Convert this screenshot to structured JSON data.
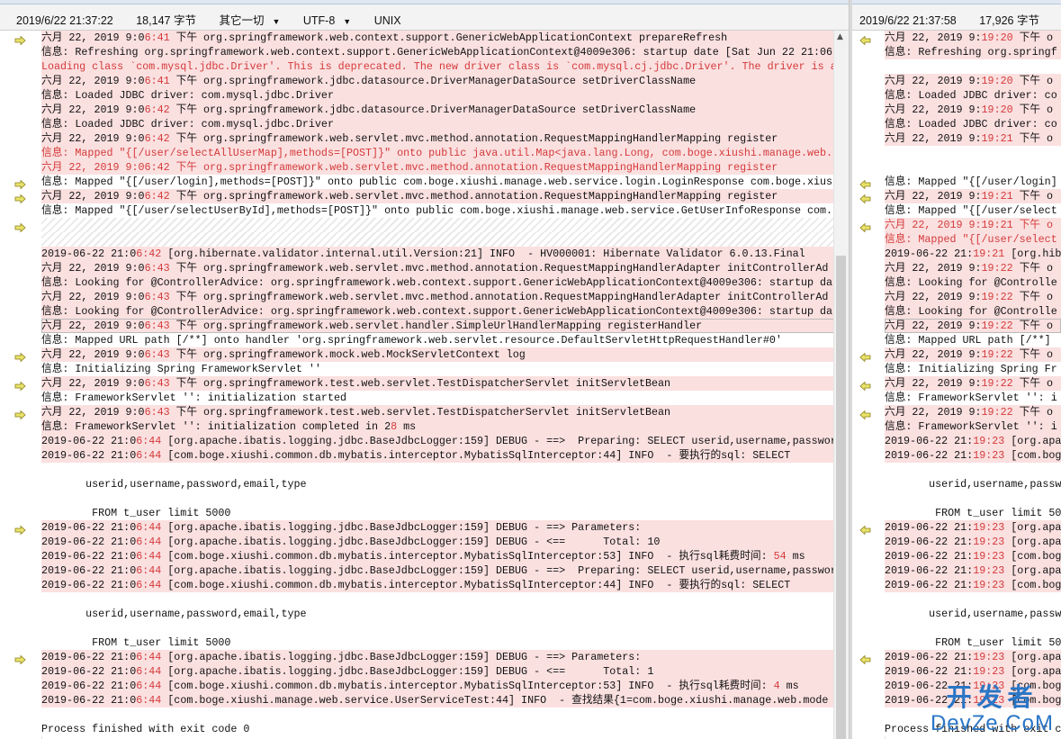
{
  "left_status": {
    "timestamp": "2019/6/22 21:37:22",
    "size": "18,147 字节",
    "filter": "其它一切",
    "encoding": "UTF-8",
    "lineend": "UNIX"
  },
  "right_status": {
    "timestamp": "2019/6/22 21:37:58",
    "size": "17,926 字节",
    "filter": "其"
  },
  "colors": {
    "diff_bg": "#fbe0e0",
    "highlight": "#d43a3a",
    "arrow": "#e9e36a",
    "watermark": "#2a76c6"
  },
  "icon_names": [
    "diff-arrow-icon",
    "scroll-up-icon"
  ],
  "left_lines": [
    {
      "t": "六月 22, 2019 9:0",
      "h": "6:41",
      "t2": " 下午 org.springframework.web.context.support.GenericWebApplicationContext prepareRefresh",
      "s": "d",
      "a": 1
    },
    {
      "t": "信息: Refreshing org.springframework.web.context.support.GenericWebApplicationContext@4009e306: startup date [Sat Jun 22 21:06",
      "s": "d"
    },
    {
      "t": "Loading class `com.mysql.jdbc.Driver'. This is deprecated. The new driver class is `com.mysql.cj.jdbc.Driver'. The driver is a",
      "s": "d red"
    },
    {
      "t": "六月 22, 2019 9:0",
      "h": "6:41",
      "t2": " 下午 org.springframework.jdbc.datasource.DriverManagerDataSource setDriverClassName",
      "s": "d"
    },
    {
      "t": "信息: Loaded JDBC driver: com.mysql.jdbc.Driver",
      "s": "d"
    },
    {
      "t": "六月 22, 2019 9:0",
      "h": "6:42",
      "t2": " 下午 org.springframework.jdbc.datasource.DriverManagerDataSource setDriverClassName",
      "s": "d"
    },
    {
      "t": "信息: Loaded JDBC driver: com.mysql.jdbc.Driver",
      "s": "d"
    },
    {
      "t": "六月 22, 2019 9:0",
      "h": "6:42",
      "t2": " 下午 org.springframework.web.servlet.mvc.method.annotation.RequestMappingHandlerMapping register",
      "s": "d"
    },
    {
      "t": "信息: Mapped \"{[/user/selectAllUserMap],methods=[POST]}\" onto public java.util.Map<java.lang.Long, com.boge.xiushi.manage.web.",
      "s": "d red"
    },
    {
      "t": "六月 22, 2019 9:06:42 下午 org.springframework.web.servlet.mvc.method.annotation.RequestMappingHandlerMapping register",
      "s": "d red"
    },
    {
      "t": "信息: Mapped \"{[/user/login],methods=[POST]}\" onto public com.boge.xiushi.manage.web.service.login.LoginResponse com.boge.xius",
      "s": "gap",
      "a": 1
    },
    {
      "t": "六月 22, 2019 9:0",
      "h": "6:42",
      "t2": " 下午 org.springframework.web.servlet.mvc.method.annotation.RequestMappingHandlerMapping register",
      "s": "d",
      "a": 1
    },
    {
      "t": "信息: Mapped \"{[/user/selectUserById],methods=[POST]}\" onto public com.boge.xiushi.manage.web.service.GetUserInfoResponse com.",
      "s": "gap"
    },
    {
      "t": "",
      "s": "hatch",
      "a": 1
    },
    {
      "t": "",
      "s": "hatch"
    },
    {
      "t": "2019-06-22 21:0",
      "h": "6:42",
      "t2": " [org.hibernate.validator.internal.util.Version:21] INFO  - HV000001: Hibernate Validator 6.0.13.Final",
      "s": "d"
    },
    {
      "t": "六月 22, 2019 9:0",
      "h": "6:43",
      "t2": " 下午 org.springframework.web.servlet.mvc.method.annotation.RequestMappingHandlerAdapter initControllerAd",
      "s": "d"
    },
    {
      "t": "信息: Looking for @ControllerAdvice: org.springframework.web.context.support.GenericWebApplicationContext@4009e306: startup da",
      "s": "d"
    },
    {
      "t": "六月 22, 2019 9:0",
      "h": "6:43",
      "t2": " 下午 org.springframework.web.servlet.mvc.method.annotation.RequestMappingHandlerAdapter initControllerAd",
      "s": "d"
    },
    {
      "t": "信息: Looking for @ControllerAdvice: org.springframework.web.context.support.GenericWebApplicationContext@4009e306: startup da",
      "s": "d"
    },
    {
      "t": "六月 22, 2019 9:0",
      "h": "6:43",
      "t2": " 下午 org.springframework.web.servlet.handler.SimpleUrlHandlerMapping registerHandler",
      "s": "d sel"
    },
    {
      "t": "信息: Mapped URL path [/**] onto handler 'org.springframework.web.servlet.resource.DefaultServletHttpRequestHandler#0'",
      "s": "gap"
    },
    {
      "t": "六月 22, 2019 9:0",
      "h": "6:43",
      "t2": " 下午 org.springframework.mock.web.MockServletContext log",
      "s": "d",
      "a": 1
    },
    {
      "t": "信息: Initializing Spring FrameworkServlet ''",
      "s": "gap"
    },
    {
      "t": "六月 22, 2019 9:0",
      "h": "6:43",
      "t2": " 下午 org.springframework.test.web.servlet.TestDispatcherServlet initServletBean",
      "s": "d",
      "a": 1
    },
    {
      "t": "信息: FrameworkServlet '': initialization started",
      "s": "gap"
    },
    {
      "t": "六月 22, 2019 9:0",
      "h": "6:43",
      "t2": " 下午 org.springframework.test.web.servlet.TestDispatcherServlet initServletBean",
      "s": "d",
      "a": 1
    },
    {
      "t": "信息: FrameworkServlet '': initialization completed in 2",
      "h": "8",
      "t2": " ms",
      "s": "d"
    },
    {
      "t": "2019-06-22 21:0",
      "h": "6:44",
      "t2": " [org.apache.ibatis.logging.jdbc.BaseJdbcLogger:159] DEBUG - ==>  Preparing: SELECT userid,username,passwor",
      "s": "d"
    },
    {
      "t": "2019-06-22 21:0",
      "h": "6:44",
      "t2": " [com.boge.xiushi.common.db.mybatis.interceptor.MybatisSqlInterceptor:44] INFO  - 要执行的sql: SELECT",
      "s": "d"
    },
    {
      "t": "",
      "s": "gap"
    },
    {
      "t": "       userid,username,password,email,type",
      "s": "gap"
    },
    {
      "t": "",
      "s": "gap"
    },
    {
      "t": "        FROM t_user limit 5000",
      "s": "gap"
    },
    {
      "t": "2019-06-22 21:0",
      "h": "6:44",
      "t2": " [org.apache.ibatis.logging.jdbc.BaseJdbcLogger:159] DEBUG - ==> Parameters:",
      "s": "d",
      "a": 1
    },
    {
      "t": "2019-06-22 21:0",
      "h": "6:44",
      "t2": " [org.apache.ibatis.logging.jdbc.BaseJdbcLogger:159] DEBUG - <==      Total: 10",
      "s": "d"
    },
    {
      "t": "2019-06-22 21:0",
      "h": "6:44",
      "t2": " [com.boge.xiushi.common.db.mybatis.interceptor.MybatisSqlInterceptor:53] INFO  - 执行sql耗费时间: ",
      "h2": "54",
      "t3": " ms",
      "s": "d"
    },
    {
      "t": "2019-06-22 21:0",
      "h": "6:44",
      "t2": " [org.apache.ibatis.logging.jdbc.BaseJdbcLogger:159] DEBUG - ==>  Preparing: SELECT userid,username,passwor",
      "s": "d"
    },
    {
      "t": "2019-06-22 21:0",
      "h": "6:44",
      "t2": " [com.boge.xiushi.common.db.mybatis.interceptor.MybatisSqlInterceptor:44] INFO  - 要执行的sql: SELECT",
      "s": "d"
    },
    {
      "t": "",
      "s": "gap"
    },
    {
      "t": "       userid,username,password,email,type",
      "s": "gap"
    },
    {
      "t": "",
      "s": "gap"
    },
    {
      "t": "        FROM t_user limit 5000",
      "s": "gap"
    },
    {
      "t": "2019-06-22 21:0",
      "h": "6:44",
      "t2": " [org.apache.ibatis.logging.jdbc.BaseJdbcLogger:159] DEBUG - ==> Parameters:",
      "s": "d",
      "a": 1
    },
    {
      "t": "2019-06-22 21:0",
      "h": "6:44",
      "t2": " [org.apache.ibatis.logging.jdbc.BaseJdbcLogger:159] DEBUG - <==      Total: 1",
      "s": "d"
    },
    {
      "t": "2019-06-22 21:0",
      "h": "6:44",
      "t2": " [com.boge.xiushi.common.db.mybatis.interceptor.MybatisSqlInterceptor:53] INFO  - 执行sql耗费时间: ",
      "h2": "4",
      "t3": " ms",
      "s": "d"
    },
    {
      "t": "2019-06-22 21:0",
      "h": "6:44",
      "t2": " [com.boge.xiushi.manage.web.service.UserServiceTest:44] INFO  - 查找结果{1=com.boge.xiushi.manage.web.mode",
      "s": "d"
    },
    {
      "t": "",
      "s": "gap"
    },
    {
      "t": "Process finished with exit code 0",
      "s": "gap"
    }
  ],
  "right_lines": [
    {
      "t": "六月 22, 2019 9:",
      "h": "19:20",
      "t2": " 下午 o",
      "s": "d",
      "a": 1
    },
    {
      "t": "信息: Refreshing org.springf",
      "s": "d"
    },
    {
      "t": "",
      "s": "gap"
    },
    {
      "t": "六月 22, 2019 9:",
      "h": "19:20",
      "t2": " 下午 o",
      "s": "d"
    },
    {
      "t": "信息: Loaded JDBC driver: co",
      "s": "d"
    },
    {
      "t": "六月 22, 2019 9:",
      "h": "19:20",
      "t2": " 下午 o",
      "s": "d"
    },
    {
      "t": "信息: Loaded JDBC driver: co",
      "s": "d"
    },
    {
      "t": "六月 22, 2019 9:",
      "h": "19:21",
      "t2": " 下午 o",
      "s": "d"
    },
    {
      "t": "",
      "s": "gap"
    },
    {
      "t": "",
      "s": "gap"
    },
    {
      "t": "信息: Mapped \"{[/user/login]",
      "s": "gap",
      "a": 1
    },
    {
      "t": "六月 22, 2019 9:",
      "h": "19:21",
      "t2": " 下午 o",
      "s": "d",
      "a": 1
    },
    {
      "t": "信息: Mapped \"{[/user/select",
      "s": "gap"
    },
    {
      "t": "六月 22, 2019 9:19:21 下午 o",
      "s": "d red",
      "a": 1
    },
    {
      "t": "信息: Mapped \"{[/user/select",
      "s": "d red"
    },
    {
      "t": "2019-06-22 21:",
      "h": "19:21",
      "t2": " [org.hib",
      "s": "d"
    },
    {
      "t": "六月 22, 2019 9:",
      "h": "19:22",
      "t2": " 下午 o",
      "s": "d"
    },
    {
      "t": "信息: Looking for @Controlle",
      "s": "d"
    },
    {
      "t": "六月 22, 2019 9:",
      "h": "19:22",
      "t2": " 下午 o",
      "s": "d"
    },
    {
      "t": "信息: Looking for @Controlle",
      "s": "d"
    },
    {
      "t": "六月 22, 2019 9:",
      "h": "19:22",
      "t2": " 下午 o",
      "s": "d sel"
    },
    {
      "t": "信息: Mapped URL path [/**]",
      "s": "gap"
    },
    {
      "t": "六月 22, 2019 9:",
      "h": "19:22",
      "t2": " 下午 o",
      "s": "d",
      "a": 1
    },
    {
      "t": "信息: Initializing Spring Fr",
      "s": "gap"
    },
    {
      "t": "六月 22, 2019 9:",
      "h": "19:22",
      "t2": " 下午 o",
      "s": "d",
      "a": 1
    },
    {
      "t": "信息: FrameworkServlet '': i",
      "s": "gap"
    },
    {
      "t": "六月 22, 2019 9:",
      "h": "19:22",
      "t2": " 下午 o",
      "s": "d",
      "a": 1
    },
    {
      "t": "信息: FrameworkServlet '': i",
      "s": "d"
    },
    {
      "t": "2019-06-22 21:",
      "h": "19:23",
      "t2": " [org.apa",
      "s": "d"
    },
    {
      "t": "2019-06-22 21:",
      "h": "19:23",
      "t2": " [com.bog",
      "s": "d"
    },
    {
      "t": "",
      "s": "gap"
    },
    {
      "t": "       userid,username,passw",
      "s": "gap"
    },
    {
      "t": "",
      "s": "gap"
    },
    {
      "t": "        FROM t_user limit 50",
      "s": "gap"
    },
    {
      "t": "2019-06-22 21:",
      "h": "19:23",
      "t2": " [org.apa",
      "s": "d",
      "a": 1
    },
    {
      "t": "2019-06-22 21:",
      "h": "19:23",
      "t2": " [org.apa",
      "s": "d"
    },
    {
      "t": "2019-06-22 21:",
      "h": "19:23",
      "t2": " [com.bog",
      "s": "d"
    },
    {
      "t": "2019-06-22 21:",
      "h": "19:23",
      "t2": " [org.apa",
      "s": "d"
    },
    {
      "t": "2019-06-22 21:",
      "h": "19:23",
      "t2": " [com.bog",
      "s": "d"
    },
    {
      "t": "",
      "s": "gap"
    },
    {
      "t": "       userid,username,passw",
      "s": "gap"
    },
    {
      "t": "",
      "s": "gap"
    },
    {
      "t": "        FROM t_user limit 50",
      "s": "gap"
    },
    {
      "t": "2019-06-22 21:",
      "h": "19:23",
      "t2": " [org.apa",
      "s": "d",
      "a": 1
    },
    {
      "t": "2019-06-22 21:",
      "h": "19:23",
      "t2": " [org.apa",
      "s": "d"
    },
    {
      "t": "2019-06-22 21:",
      "h": "19:23",
      "t2": " [com.bog",
      "s": "d"
    },
    {
      "t": "2019-06-22 21:",
      "h": "19:23",
      "t2": " [com.bog",
      "s": "d"
    },
    {
      "t": "",
      "s": "gap"
    },
    {
      "t": "Process finished with exit c",
      "s": "gap"
    }
  ],
  "watermark": {
    "top": "开发者",
    "bottom": "DevZe.CoM"
  }
}
